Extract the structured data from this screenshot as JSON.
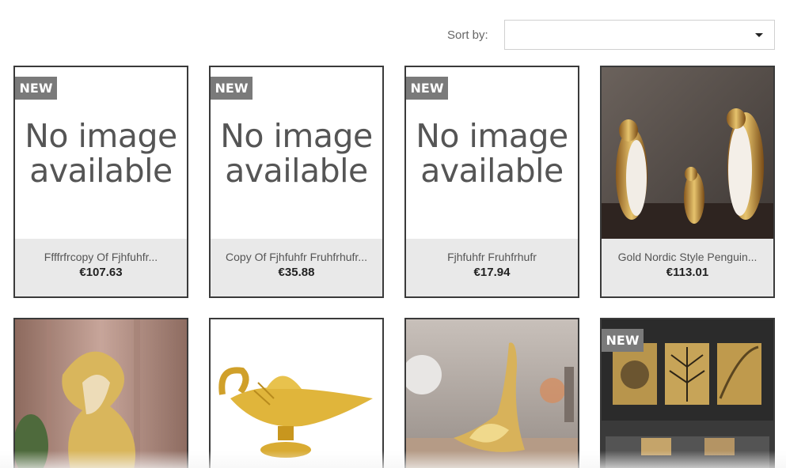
{
  "sort": {
    "label": "Sort by:",
    "value": ""
  },
  "products": [
    {
      "badge": "NEW",
      "image_text": [
        "No image",
        "available"
      ],
      "name": "Ffffrfrcopy Of Fjhfuhfr...",
      "price": "€107.63"
    },
    {
      "badge": "NEW",
      "image_text": [
        "No image",
        "available"
      ],
      "name": "Copy Of Fjhfuhfr Fruhfrhufr...",
      "price": "€35.88"
    },
    {
      "badge": "NEW",
      "image_text": [
        "No image",
        "available"
      ],
      "name": "Fjhfuhfr Fruhfrhufr",
      "price": "€17.94"
    },
    {
      "badge": "",
      "image": "gold-penguins-photo",
      "name": "Gold Nordic Style Penguin...",
      "price": "€113.01"
    },
    {
      "badge": "",
      "image": "gold-horse-statue-photo"
    },
    {
      "badge": "",
      "image": "gold-genie-lamp-photo"
    },
    {
      "badge": "",
      "image": "gold-banana-sculpture-photo"
    },
    {
      "badge": "NEW",
      "image": "gold-leaf-wall-art-photo"
    }
  ],
  "colors": {
    "card_border": "#3a3a3a",
    "info_bg": "#e9e9e9",
    "badge_bg": "#7a7a7a"
  }
}
